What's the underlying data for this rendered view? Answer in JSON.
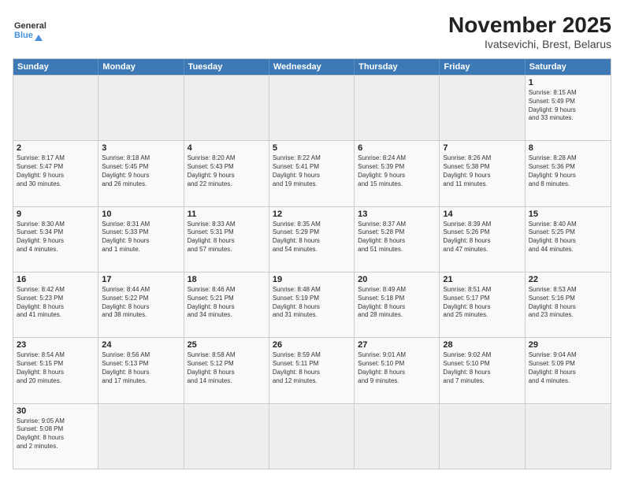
{
  "header": {
    "logo_general": "General",
    "logo_blue": "Blue",
    "month_title": "November 2025",
    "location": "Ivatsevichi, Brest, Belarus"
  },
  "day_headers": [
    "Sunday",
    "Monday",
    "Tuesday",
    "Wednesday",
    "Thursday",
    "Friday",
    "Saturday"
  ],
  "weeks": [
    {
      "days": [
        {
          "number": "",
          "info": "",
          "empty": true
        },
        {
          "number": "",
          "info": "",
          "empty": true
        },
        {
          "number": "",
          "info": "",
          "empty": true
        },
        {
          "number": "",
          "info": "",
          "empty": true
        },
        {
          "number": "",
          "info": "",
          "empty": true
        },
        {
          "number": "",
          "info": "",
          "empty": true
        },
        {
          "number": "1",
          "info": "Sunrise: 8:15 AM\nSunset: 5:49 PM\nDaylight: 9 hours\nand 33 minutes.",
          "empty": false
        }
      ]
    },
    {
      "days": [
        {
          "number": "2",
          "info": "Sunrise: 8:17 AM\nSunset: 5:47 PM\nDaylight: 9 hours\nand 30 minutes.",
          "empty": false
        },
        {
          "number": "3",
          "info": "Sunrise: 8:18 AM\nSunset: 5:45 PM\nDaylight: 9 hours\nand 26 minutes.",
          "empty": false
        },
        {
          "number": "4",
          "info": "Sunrise: 8:20 AM\nSunset: 5:43 PM\nDaylight: 9 hours\nand 22 minutes.",
          "empty": false
        },
        {
          "number": "5",
          "info": "Sunrise: 8:22 AM\nSunset: 5:41 PM\nDaylight: 9 hours\nand 19 minutes.",
          "empty": false
        },
        {
          "number": "6",
          "info": "Sunrise: 8:24 AM\nSunset: 5:39 PM\nDaylight: 9 hours\nand 15 minutes.",
          "empty": false
        },
        {
          "number": "7",
          "info": "Sunrise: 8:26 AM\nSunset: 5:38 PM\nDaylight: 9 hours\nand 11 minutes.",
          "empty": false
        },
        {
          "number": "8",
          "info": "Sunrise: 8:28 AM\nSunset: 5:36 PM\nDaylight: 9 hours\nand 8 minutes.",
          "empty": false
        }
      ]
    },
    {
      "days": [
        {
          "number": "9",
          "info": "Sunrise: 8:30 AM\nSunset: 5:34 PM\nDaylight: 9 hours\nand 4 minutes.",
          "empty": false
        },
        {
          "number": "10",
          "info": "Sunrise: 8:31 AM\nSunset: 5:33 PM\nDaylight: 9 hours\nand 1 minute.",
          "empty": false
        },
        {
          "number": "11",
          "info": "Sunrise: 8:33 AM\nSunset: 5:31 PM\nDaylight: 8 hours\nand 57 minutes.",
          "empty": false
        },
        {
          "number": "12",
          "info": "Sunrise: 8:35 AM\nSunset: 5:29 PM\nDaylight: 8 hours\nand 54 minutes.",
          "empty": false
        },
        {
          "number": "13",
          "info": "Sunrise: 8:37 AM\nSunset: 5:28 PM\nDaylight: 8 hours\nand 51 minutes.",
          "empty": false
        },
        {
          "number": "14",
          "info": "Sunrise: 8:39 AM\nSunset: 5:26 PM\nDaylight: 8 hours\nand 47 minutes.",
          "empty": false
        },
        {
          "number": "15",
          "info": "Sunrise: 8:40 AM\nSunset: 5:25 PM\nDaylight: 8 hours\nand 44 minutes.",
          "empty": false
        }
      ]
    },
    {
      "days": [
        {
          "number": "16",
          "info": "Sunrise: 8:42 AM\nSunset: 5:23 PM\nDaylight: 8 hours\nand 41 minutes.",
          "empty": false
        },
        {
          "number": "17",
          "info": "Sunrise: 8:44 AM\nSunset: 5:22 PM\nDaylight: 8 hours\nand 38 minutes.",
          "empty": false
        },
        {
          "number": "18",
          "info": "Sunrise: 8:46 AM\nSunset: 5:21 PM\nDaylight: 8 hours\nand 34 minutes.",
          "empty": false
        },
        {
          "number": "19",
          "info": "Sunrise: 8:48 AM\nSunset: 5:19 PM\nDaylight: 8 hours\nand 31 minutes.",
          "empty": false
        },
        {
          "number": "20",
          "info": "Sunrise: 8:49 AM\nSunset: 5:18 PM\nDaylight: 8 hours\nand 28 minutes.",
          "empty": false
        },
        {
          "number": "21",
          "info": "Sunrise: 8:51 AM\nSunset: 5:17 PM\nDaylight: 8 hours\nand 25 minutes.",
          "empty": false
        },
        {
          "number": "22",
          "info": "Sunrise: 8:53 AM\nSunset: 5:16 PM\nDaylight: 8 hours\nand 23 minutes.",
          "empty": false
        }
      ]
    },
    {
      "days": [
        {
          "number": "23",
          "info": "Sunrise: 8:54 AM\nSunset: 5:15 PM\nDaylight: 8 hours\nand 20 minutes.",
          "empty": false
        },
        {
          "number": "24",
          "info": "Sunrise: 8:56 AM\nSunset: 5:13 PM\nDaylight: 8 hours\nand 17 minutes.",
          "empty": false
        },
        {
          "number": "25",
          "info": "Sunrise: 8:58 AM\nSunset: 5:12 PM\nDaylight: 8 hours\nand 14 minutes.",
          "empty": false
        },
        {
          "number": "26",
          "info": "Sunrise: 8:59 AM\nSunset: 5:11 PM\nDaylight: 8 hours\nand 12 minutes.",
          "empty": false
        },
        {
          "number": "27",
          "info": "Sunrise: 9:01 AM\nSunset: 5:10 PM\nDaylight: 8 hours\nand 9 minutes.",
          "empty": false
        },
        {
          "number": "28",
          "info": "Sunrise: 9:02 AM\nSunset: 5:10 PM\nDaylight: 8 hours\nand 7 minutes.",
          "empty": false
        },
        {
          "number": "29",
          "info": "Sunrise: 9:04 AM\nSunset: 5:09 PM\nDaylight: 8 hours\nand 4 minutes.",
          "empty": false
        }
      ]
    },
    {
      "days": [
        {
          "number": "30",
          "info": "Sunrise: 9:05 AM\nSunset: 5:08 PM\nDaylight: 8 hours\nand 2 minutes.",
          "empty": false
        },
        {
          "number": "",
          "info": "",
          "empty": true
        },
        {
          "number": "",
          "info": "",
          "empty": true
        },
        {
          "number": "",
          "info": "",
          "empty": true
        },
        {
          "number": "",
          "info": "",
          "empty": true
        },
        {
          "number": "",
          "info": "",
          "empty": true
        },
        {
          "number": "",
          "info": "",
          "empty": true
        }
      ]
    }
  ]
}
